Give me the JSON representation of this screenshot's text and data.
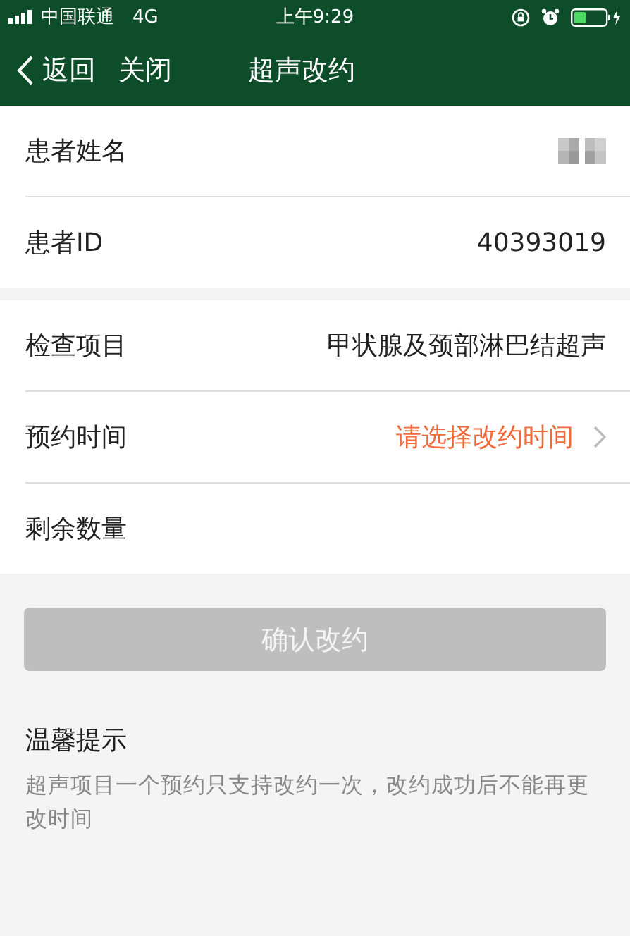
{
  "status_bar": {
    "carrier": "中国联通",
    "network": "4G",
    "time": "上午9:29"
  },
  "nav": {
    "back": "返回",
    "close": "关闭",
    "title": "超声改约"
  },
  "groups": [
    {
      "rows": [
        {
          "kind": "redacted",
          "label": "患者姓名"
        },
        {
          "kind": "text",
          "label": "患者ID",
          "value": "40393019"
        }
      ]
    },
    {
      "rows": [
        {
          "kind": "text",
          "label": "检查项目",
          "value": "甲状腺及颈部淋巴结超声"
        },
        {
          "kind": "select",
          "label": "预约时间",
          "placeholder": "请选择改约时间"
        },
        {
          "kind": "empty",
          "label": "剩余数量"
        }
      ]
    }
  ],
  "confirm_button": {
    "label": "确认改约",
    "disabled": true
  },
  "tips": {
    "title": "温馨提示",
    "text": "超声项目一个预约只支持改约一次，改约成功后不能再更改时间"
  }
}
